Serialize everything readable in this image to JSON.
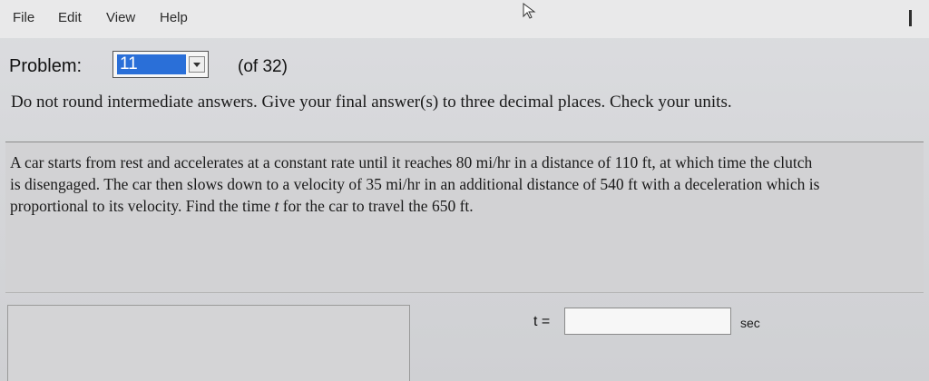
{
  "menu": [
    "File",
    "Edit",
    "View",
    "Help"
  ],
  "problem": {
    "label": "Problem:",
    "selected": "11",
    "of_count": "(of 32)"
  },
  "instructions": "Do not round intermediate answers. Give your final answer(s) to three decimal places. Check your units.",
  "question": {
    "line1": "A car starts from rest and accelerates at a constant rate until it reaches 80 mi/hr in a distance of 110 ft, at which time the clutch",
    "line2": "is disengaged. The car then slows down to a velocity of 35 mi/hr in an additional distance of 540 ft with a deceleration which is",
    "line3_pre": "proportional to its velocity. Find the time ",
    "line3_var": "t",
    "line3_post": " for the car to travel the 650 ft."
  },
  "answer": {
    "label": "t =",
    "value": "",
    "unit": "sec"
  },
  "icons": {
    "cursor": "mouse-cursor-icon",
    "dropdown": "chevron-down-icon",
    "minimize": "minimize-icon"
  }
}
